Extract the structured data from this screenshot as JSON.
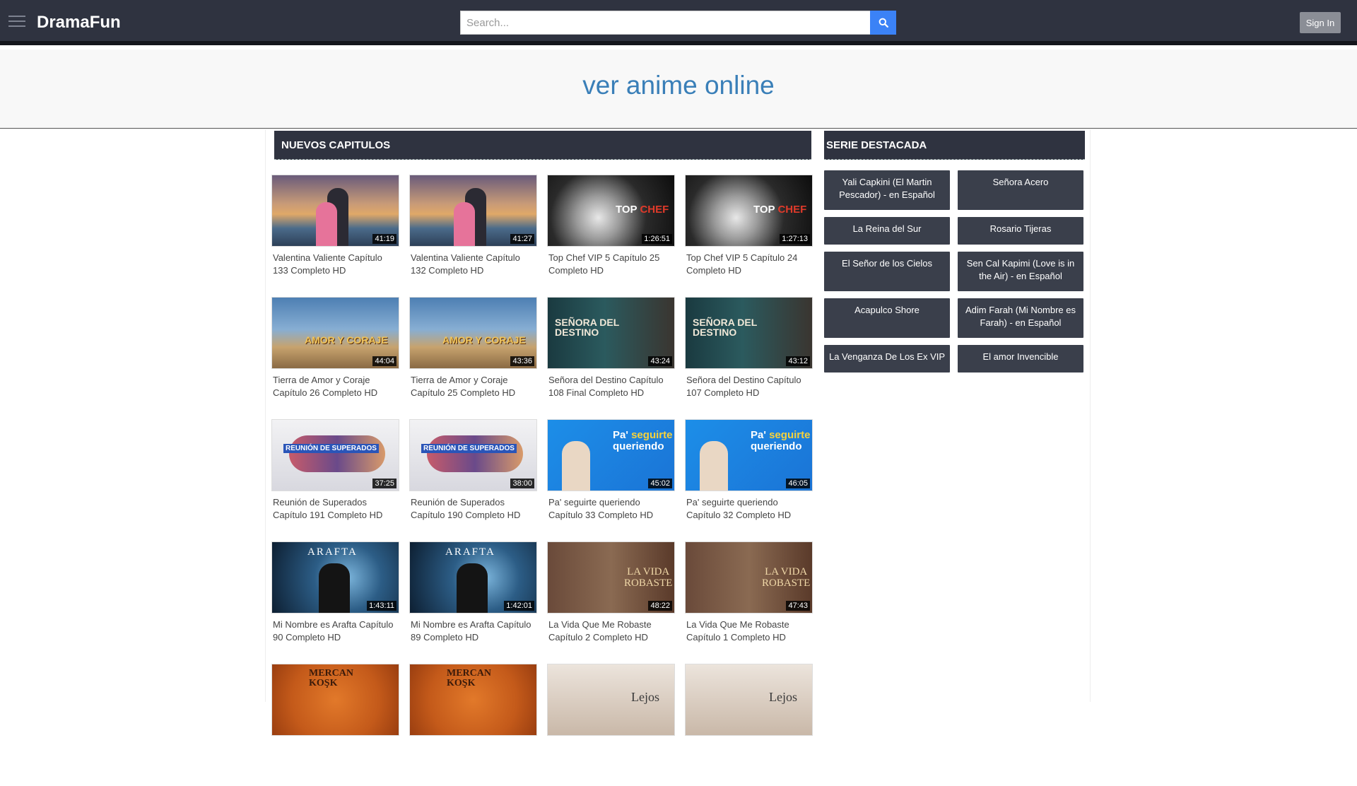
{
  "header": {
    "brand": "DramaFun",
    "search_placeholder": "Search...",
    "signin_label": "Sign In"
  },
  "banner": {
    "title": "ver anime online"
  },
  "main": {
    "heading": "NUEVOS CAPITULOS",
    "videos": [
      {
        "title": "Valentina Valiente Capítulo 133 Completo HD",
        "duration": "41:19"
      },
      {
        "title": "Valentina Valiente Capítulo 132 Completo HD",
        "duration": "41:27"
      },
      {
        "title": "Top Chef VIP 5 Capítulo 25 Completo HD",
        "duration": "1:26:51"
      },
      {
        "title": "Top Chef VIP 5 Capítulo 24 Completo HD",
        "duration": "1:27:13"
      },
      {
        "title": "Tierra de Amor y Coraje Capítulo 26 Completo HD",
        "duration": "44:04"
      },
      {
        "title": "Tierra de Amor y Coraje Capítulo 25 Completo HD",
        "duration": "43:36"
      },
      {
        "title": "Señora del Destino Capítulo 108 Final Completo HD",
        "duration": "43:24"
      },
      {
        "title": "Señora del Destino Capítulo 107 Completo HD",
        "duration": "43:12"
      },
      {
        "title": "Reunión de Superados Capítulo 191 Completo HD",
        "duration": "37:25"
      },
      {
        "title": "Reunión de Superados Capítulo 190 Completo HD",
        "duration": "38:00"
      },
      {
        "title": "Pa' seguirte queriendo Capítulo 33 Completo HD",
        "duration": "45:02"
      },
      {
        "title": "Pa' seguirte queriendo Capítulo 32 Completo HD",
        "duration": "46:05"
      },
      {
        "title": "Mi Nombre es Arafta Capítulo 90 Completo HD",
        "duration": "1:43:11"
      },
      {
        "title": "Mi Nombre es Arafta Capítulo 89 Completo HD",
        "duration": "1:42:01"
      },
      {
        "title": "La Vida Que Me Robaste Capítulo 2 Completo HD",
        "duration": "48:22"
      },
      {
        "title": "La Vida Que Me Robaste Capítulo 1 Completo HD",
        "duration": "47:43"
      }
    ],
    "thumb_art": {
      "topchef_logo_a": "TOP",
      "topchef_logo_b": "CHEF",
      "tierra_logo": "AMOR Y CORAJE",
      "senora_logo_a": "SEÑORA DEL",
      "senora_logo_b": "DESTINO",
      "reunion_logo": "REUNIÓN DE SUPERADOS",
      "pa_logo_a": "Pa'",
      "pa_logo_b": "seguirte",
      "pa_logo_c": "queriendo",
      "arafta_logo": "ARAFTA",
      "vida_logo_a": "LA VIDA",
      "vida_logo_b": "ROBASTE",
      "mercan_logo_a": "MERCAN",
      "mercan_logo_b": "KOŞK",
      "lejos_logo": "Lejos"
    }
  },
  "sidebar": {
    "heading": "SERIE DESTACADA",
    "series": [
      "Yali Capkini (El Martin Pescador) - en Español",
      "Señora Acero",
      "La Reina del Sur",
      "Rosario Tijeras",
      "El Señor de los Cielos",
      "Sen Cal Kapimi (Love is in the Air) - en Español",
      "Acapulco Shore",
      "Adim Farah (Mi Nombre es Farah) - en Español",
      "La Venganza De Los Ex VIP",
      "El amor Invencible"
    ]
  }
}
